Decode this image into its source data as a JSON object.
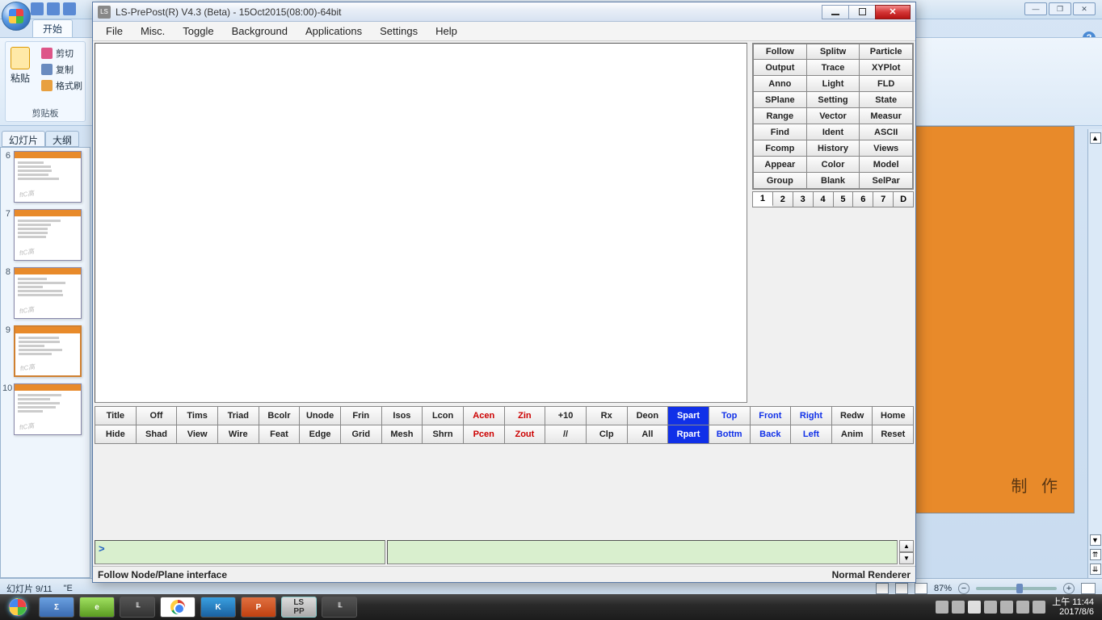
{
  "office": {
    "tab_start": "开始",
    "ribbon": {
      "paste": "粘贴",
      "cut": "剪切",
      "copy": "复制",
      "format_painter": "格式刷",
      "group_clipboard": "剪贴板"
    },
    "slide_tabs": {
      "slides": "幻灯片",
      "outline": "大纲"
    },
    "slide_numbers": [
      "6",
      "7",
      "8",
      "9",
      "10"
    ],
    "watermark": "ftC高",
    "main_slide_text": "制 作",
    "status_left": "幻灯片 9/11",
    "status_lang": "\"E",
    "zoom_pct": "87%",
    "winbtns": {
      "min": "—",
      "max": "❐",
      "close": "✕"
    }
  },
  "lspp": {
    "title": "LS-PrePost(R) V4.3 (Beta) - 15Oct2015(08:00)-64bit",
    "menu": [
      "File",
      "Misc.",
      "Toggle",
      "Background",
      "Applications",
      "Settings",
      "Help"
    ],
    "right_tools": [
      [
        "Follow",
        "Splitw",
        "Particle"
      ],
      [
        "Output",
        "Trace",
        "XYPlot"
      ],
      [
        "Anno",
        "Light",
        "FLD"
      ],
      [
        "SPlane",
        "Setting",
        "State"
      ],
      [
        "Range",
        "Vector",
        "Measur"
      ],
      [
        "Find",
        "Ident",
        "ASCII"
      ],
      [
        "Fcomp",
        "History",
        "Views"
      ],
      [
        "Appear",
        "Color",
        "Model"
      ],
      [
        "Group",
        "Blank",
        "SelPar"
      ]
    ],
    "num_tabs": [
      "1",
      "2",
      "3",
      "4",
      "5",
      "6",
      "7",
      "D"
    ],
    "bottom_row1": [
      {
        "t": "Title"
      },
      {
        "t": "Off"
      },
      {
        "t": "Tims"
      },
      {
        "t": "Triad"
      },
      {
        "t": "Bcolr"
      },
      {
        "t": "Unode"
      },
      {
        "t": "Frin"
      },
      {
        "t": "Isos"
      },
      {
        "t": "Lcon"
      },
      {
        "t": "Acen",
        "c": "red"
      },
      {
        "t": "Zin",
        "c": "red"
      },
      {
        "t": "+10"
      },
      {
        "t": "Rx"
      },
      {
        "t": "Deon"
      },
      {
        "t": "Spart",
        "c": "blue-bg"
      },
      {
        "t": "Top",
        "c": "blue-txt"
      },
      {
        "t": "Front",
        "c": "blue-txt"
      },
      {
        "t": "Right",
        "c": "blue-txt"
      },
      {
        "t": "Redw"
      },
      {
        "t": "Home"
      }
    ],
    "bottom_row2": [
      {
        "t": "Hide"
      },
      {
        "t": "Shad"
      },
      {
        "t": "View"
      },
      {
        "t": "Wire"
      },
      {
        "t": "Feat"
      },
      {
        "t": "Edge"
      },
      {
        "t": "Grid"
      },
      {
        "t": "Mesh"
      },
      {
        "t": "Shrn"
      },
      {
        "t": "Pcen",
        "c": "red"
      },
      {
        "t": "Zout",
        "c": "red"
      },
      {
        "t": "//"
      },
      {
        "t": "Clp"
      },
      {
        "t": "All"
      },
      {
        "t": "Rpart",
        "c": "blue-bg"
      },
      {
        "t": "Bottm",
        "c": "blue-txt"
      },
      {
        "t": "Back",
        "c": "blue-txt"
      },
      {
        "t": "Left",
        "c": "blue-txt"
      },
      {
        "t": "Anim"
      },
      {
        "t": "Reset"
      }
    ],
    "cmd_prompt": ">",
    "status_left": "Follow Node/Plane interface",
    "status_right": "Normal Renderer",
    "winbtns": {
      "close": "✕"
    }
  },
  "taskbar": {
    "icons": [
      {
        "name": "sigma",
        "label": "Σ"
      },
      {
        "name": "ie",
        "label": "e"
      },
      {
        "name": "lstc1",
        "label": "╙"
      },
      {
        "name": "chrome",
        "label": ""
      },
      {
        "name": "k",
        "label": "K"
      },
      {
        "name": "ppt",
        "label": "P"
      },
      {
        "name": "lspp",
        "label": "LS\nPP",
        "active": true
      },
      {
        "name": "lstc2",
        "label": "╙"
      }
    ],
    "clock_time": "上午 11:44",
    "clock_date": "2017/8/6"
  }
}
